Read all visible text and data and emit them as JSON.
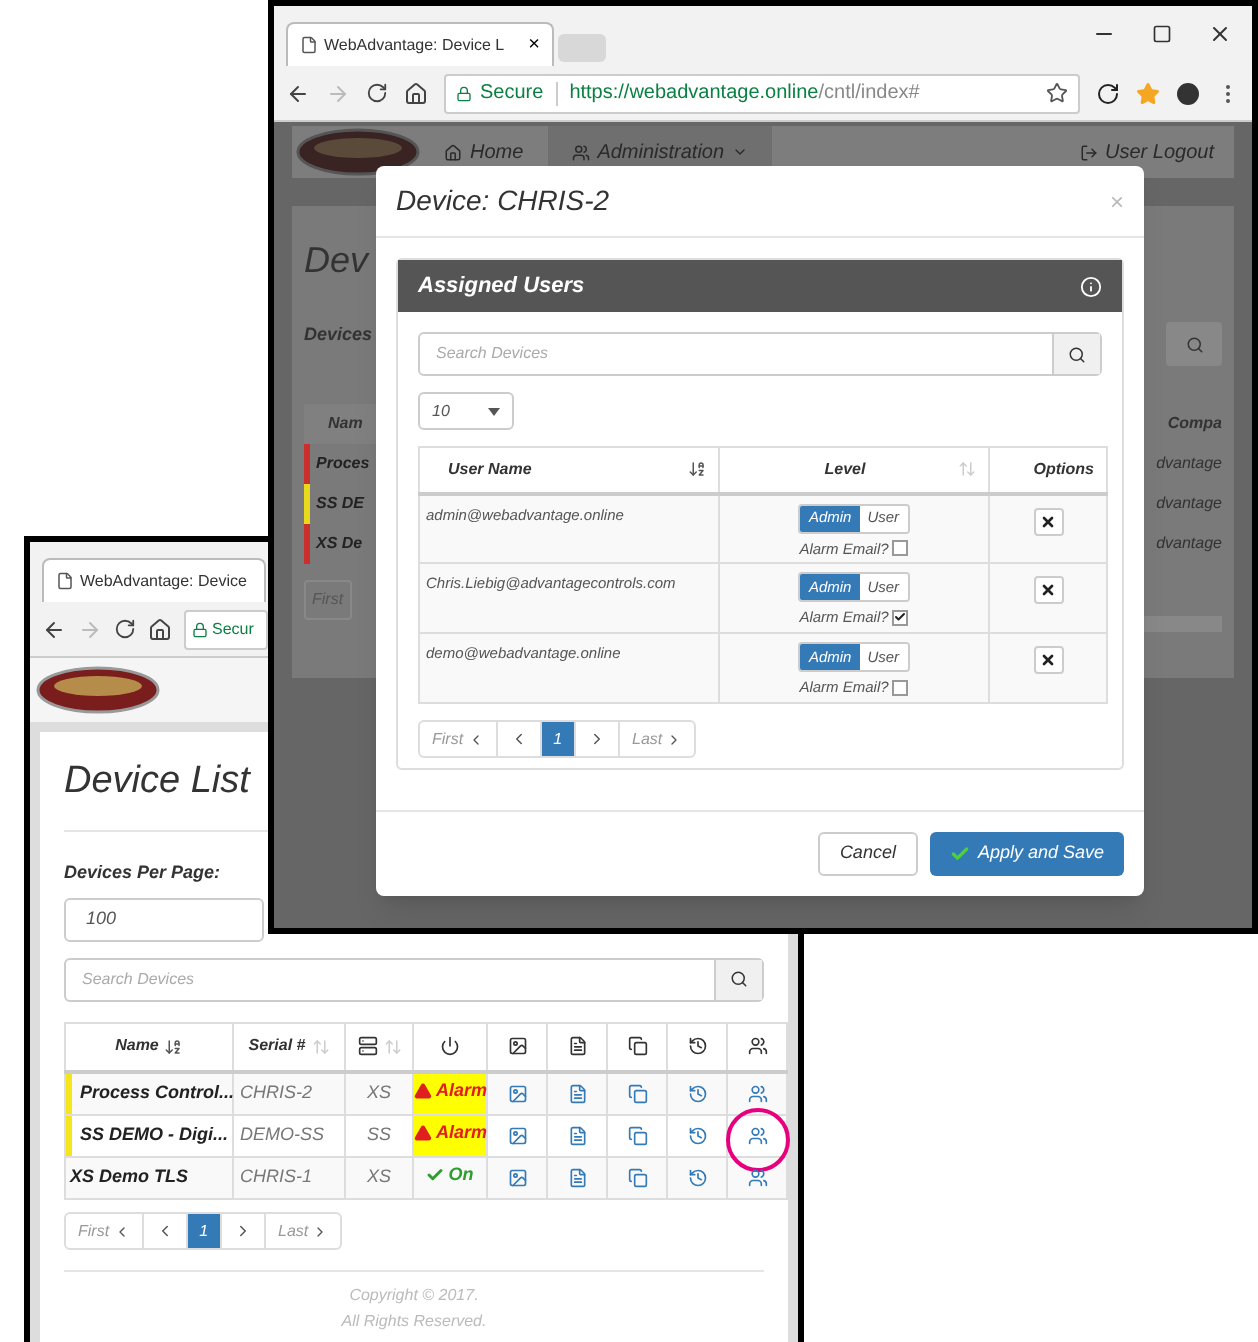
{
  "front_window": {
    "tab_title": "WebAdvantage: Device L",
    "tab_close": "×",
    "address": {
      "secure_label": "Secure",
      "url_host": "https://webadvantage.online",
      "url_path": "/cntl/index#"
    },
    "background_page": {
      "nav": [
        {
          "label": "Home",
          "kind": "home",
          "selected": false
        },
        {
          "label": "Administration",
          "kind": "admin",
          "selected": true
        }
      ],
      "logout": "User Logout",
      "heading": "Dev",
      "per_page_label": "Devices",
      "column_left": "Nam",
      "column_right": "Compa",
      "rows": [
        {
          "name": "Proces",
          "company": "dvantage",
          "color": "#c9302c"
        },
        {
          "name": "SS DE",
          "company": "dvantage",
          "color": "#e8d91d"
        },
        {
          "name": "XS De",
          "company": "dvantage",
          "color": "#c9302c"
        }
      ],
      "pagination_first": "First"
    },
    "dialog": {
      "title": "Device: CHRIS-2",
      "close": "×",
      "panel_title": "Assigned Users",
      "search": {
        "placeholder": "Search Devices"
      },
      "page_size": "10",
      "columns": [
        {
          "label": "User Name",
          "sorted": true
        },
        {
          "label": "Level",
          "sorted": false
        },
        {
          "label": "Options"
        }
      ],
      "users": [
        {
          "name": "admin@webadvantage.online",
          "levels": [
            {
              "label": "Admin",
              "selected": true
            },
            {
              "label": "User",
              "selected": false
            }
          ],
          "alarm_email": {
            "label": "Alarm Email?",
            "checked": false
          }
        },
        {
          "name": "Chris.Liebig@advantagecontrols.com",
          "levels": [
            {
              "label": "Admin",
              "selected": true
            },
            {
              "label": "User",
              "selected": false
            }
          ],
          "alarm_email": {
            "label": "Alarm Email?",
            "checked": true
          }
        },
        {
          "name": "demo@webadvantage.online",
          "levels": [
            {
              "label": "Admin",
              "selected": true
            },
            {
              "label": "User",
              "selected": false
            }
          ],
          "alarm_email": {
            "label": "Alarm Email?",
            "checked": false
          }
        }
      ],
      "pagination": {
        "first": "First",
        "pages": [
          {
            "label": "1",
            "selected": true
          }
        ],
        "last": "Last"
      },
      "buttons": [
        {
          "label": "Cancel",
          "kind": "default"
        },
        {
          "label": "Apply and Save",
          "kind": "primary"
        }
      ]
    }
  },
  "back_window": {
    "tab_title": "WebAdvantage: Device",
    "secure_label": "Secur",
    "heading": "Device List",
    "per_page": {
      "label": "Devices Per Page:",
      "value": "100"
    },
    "search": {
      "placeholder": "Search Devices"
    },
    "columns": [
      {
        "kind": "name",
        "label": "Name",
        "sorted": true
      },
      {
        "kind": "serial",
        "label": "Serial #",
        "sorted": false
      },
      {
        "kind": "model",
        "sorted": false
      },
      {
        "kind": "power"
      },
      {
        "kind": "image"
      },
      {
        "kind": "document"
      },
      {
        "kind": "copy"
      },
      {
        "kind": "history"
      },
      {
        "kind": "users"
      }
    ],
    "devices": [
      {
        "name": "Process Control...",
        "serial": "CHRIS-2",
        "model": "XS",
        "status": {
          "kind": "alarm",
          "label": "Alarm"
        },
        "color": "#f5e61b",
        "highlighted": false
      },
      {
        "name": "SS DEMO - Digi...",
        "serial": "DEMO-SS",
        "model": "SS",
        "status": {
          "kind": "alarm",
          "label": "Alarm"
        },
        "color": "#f5e61b",
        "highlighted": true
      },
      {
        "name": "XS Demo TLS",
        "serial": "CHRIS-1",
        "model": "XS",
        "status": {
          "kind": "on",
          "label": "On"
        },
        "highlighted": false
      }
    ],
    "pagination": {
      "first": "First",
      "pages": [
        {
          "label": "1",
          "selected": true
        }
      ],
      "last": "Last"
    },
    "copyright": [
      "Copyright © 2017.",
      "All Rights Reserved."
    ]
  }
}
